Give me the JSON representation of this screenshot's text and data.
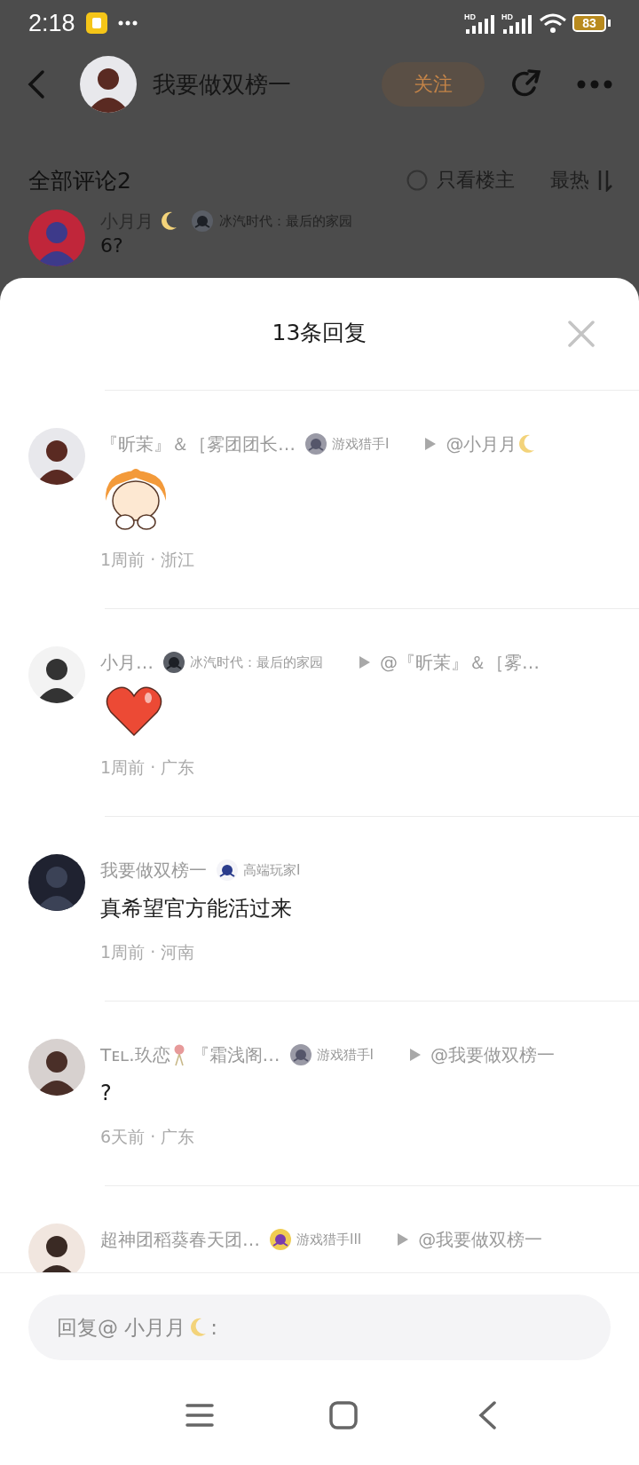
{
  "status_bar": {
    "time": "2:18",
    "signal_labels": [
      "HD",
      "HD"
    ],
    "battery": "83"
  },
  "post_header": {
    "author": "我要做双榜一",
    "follow_button": "关注"
  },
  "comments_header": {
    "title": "全部评论2",
    "op_only": {
      "label": "只看楼主",
      "checked": false
    },
    "sort": "最热"
  },
  "background_comment": {
    "name": "小月月",
    "name_emoji": {
      "kind": "moon"
    },
    "emblem": {
      "kind": "dark"
    },
    "tag": "冰汽时代：最后的家园",
    "body": "6?"
  },
  "sheet": {
    "title": "13条回复"
  },
  "replies": [
    {
      "name": "『昕茉』＆［雾团团长…",
      "emblem": {
        "kind": "gray"
      },
      "tag": "游戏猎手I",
      "reply_to": "@小月月",
      "reply_to_emoji": {
        "kind": "moon"
      },
      "body": {
        "kind": "sticker"
      },
      "meta": "1周前 · 浙江"
    },
    {
      "name": "小月…",
      "emblem": {
        "kind": "dark"
      },
      "tag": "冰汽时代：最后的家园",
      "reply_to": "@『昕茉』＆［雾…",
      "body": {
        "kind": "heart"
      },
      "meta": "1周前 · 广东"
    },
    {
      "name": "我要做双榜一",
      "emblem": {
        "kind": "pilot"
      },
      "tag": "高端玩家I",
      "body": {
        "kind": "text",
        "text": "真希望官方能活过来"
      },
      "meta": "1周前 · 河南"
    },
    {
      "name": "Tᴇʟ.玖恋",
      "name_emoji": {
        "kind": "flower"
      },
      "name_suffix": "『霜浅阁…",
      "emblem": {
        "kind": "gray"
      },
      "tag": "游戏猎手I",
      "reply_to": "@我要做双榜一",
      "body": {
        "kind": "text",
        "text": "?"
      },
      "meta": "6天前 · 广东"
    },
    {
      "name": "超神团稻葵春天团…",
      "emblem": {
        "kind": "gold"
      },
      "tag": "游戏猎手III",
      "reply_to": "@我要做双榜一"
    }
  ],
  "reply_field": {
    "placeholder": "回复@ 小月月",
    "placeholder_emoji": {
      "kind": "moon"
    },
    "placeholder_suffix": ":"
  }
}
